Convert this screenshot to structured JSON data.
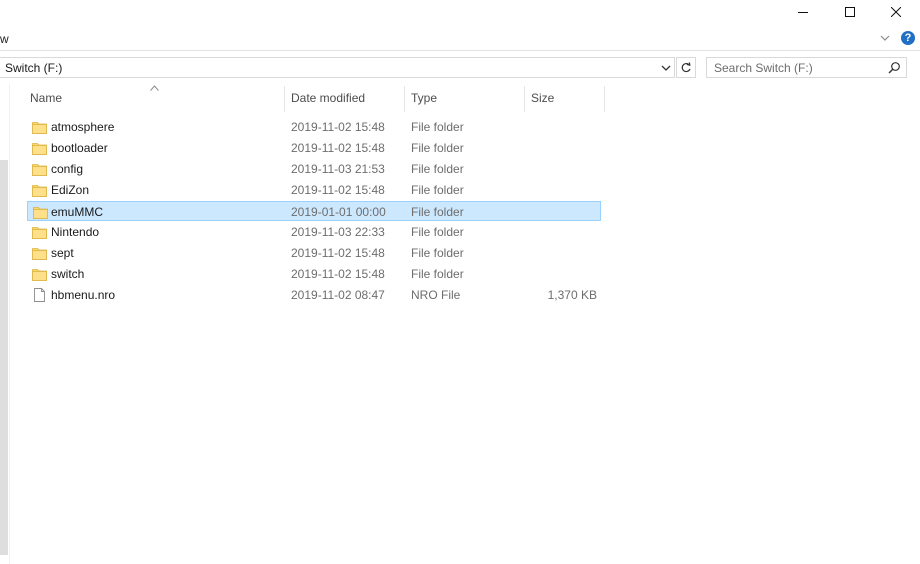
{
  "window": {
    "controls": [
      "minimize-icon",
      "maximize-icon",
      "close-icon"
    ]
  },
  "ribbon": {
    "partial_label": "w"
  },
  "address": {
    "path": "Switch (F:)"
  },
  "search": {
    "placeholder": "Search Switch (F:)"
  },
  "columns": {
    "name": "Name",
    "date": "Date modified",
    "type": "Type",
    "size": "Size",
    "sorted_by": "name"
  },
  "files": [
    {
      "name": "atmosphere",
      "date": "2019-11-02 15:48",
      "type": "File folder",
      "size": "",
      "icon": "folder-icon"
    },
    {
      "name": "bootloader",
      "date": "2019-11-02 15:48",
      "type": "File folder",
      "size": "",
      "icon": "folder-icon"
    },
    {
      "name": "config",
      "date": "2019-11-03 21:53",
      "type": "File folder",
      "size": "",
      "icon": "folder-icon"
    },
    {
      "name": "EdiZon",
      "date": "2019-11-02 15:48",
      "type": "File folder",
      "size": "",
      "icon": "folder-icon"
    },
    {
      "name": "emuMMC",
      "date": "2019-01-01 00:00",
      "type": "File folder",
      "size": "",
      "icon": "folder-icon",
      "selected": true
    },
    {
      "name": "Nintendo",
      "date": "2019-11-03 22:33",
      "type": "File folder",
      "size": "",
      "icon": "folder-icon"
    },
    {
      "name": "sept",
      "date": "2019-11-02 15:48",
      "type": "File folder",
      "size": "",
      "icon": "folder-icon"
    },
    {
      "name": "switch",
      "date": "2019-11-02 15:48",
      "type": "File folder",
      "size": "",
      "icon": "folder-icon"
    },
    {
      "name": "hbmenu.nro",
      "date": "2019-11-02 08:47",
      "type": "NRO File",
      "size": "1,370 KB",
      "icon": "file-icon"
    }
  ],
  "colors": {
    "selection_bg": "#cce8ff",
    "selection_border": "#99d1ff",
    "folder": "#ffd766",
    "help": "#1f6fc5"
  }
}
